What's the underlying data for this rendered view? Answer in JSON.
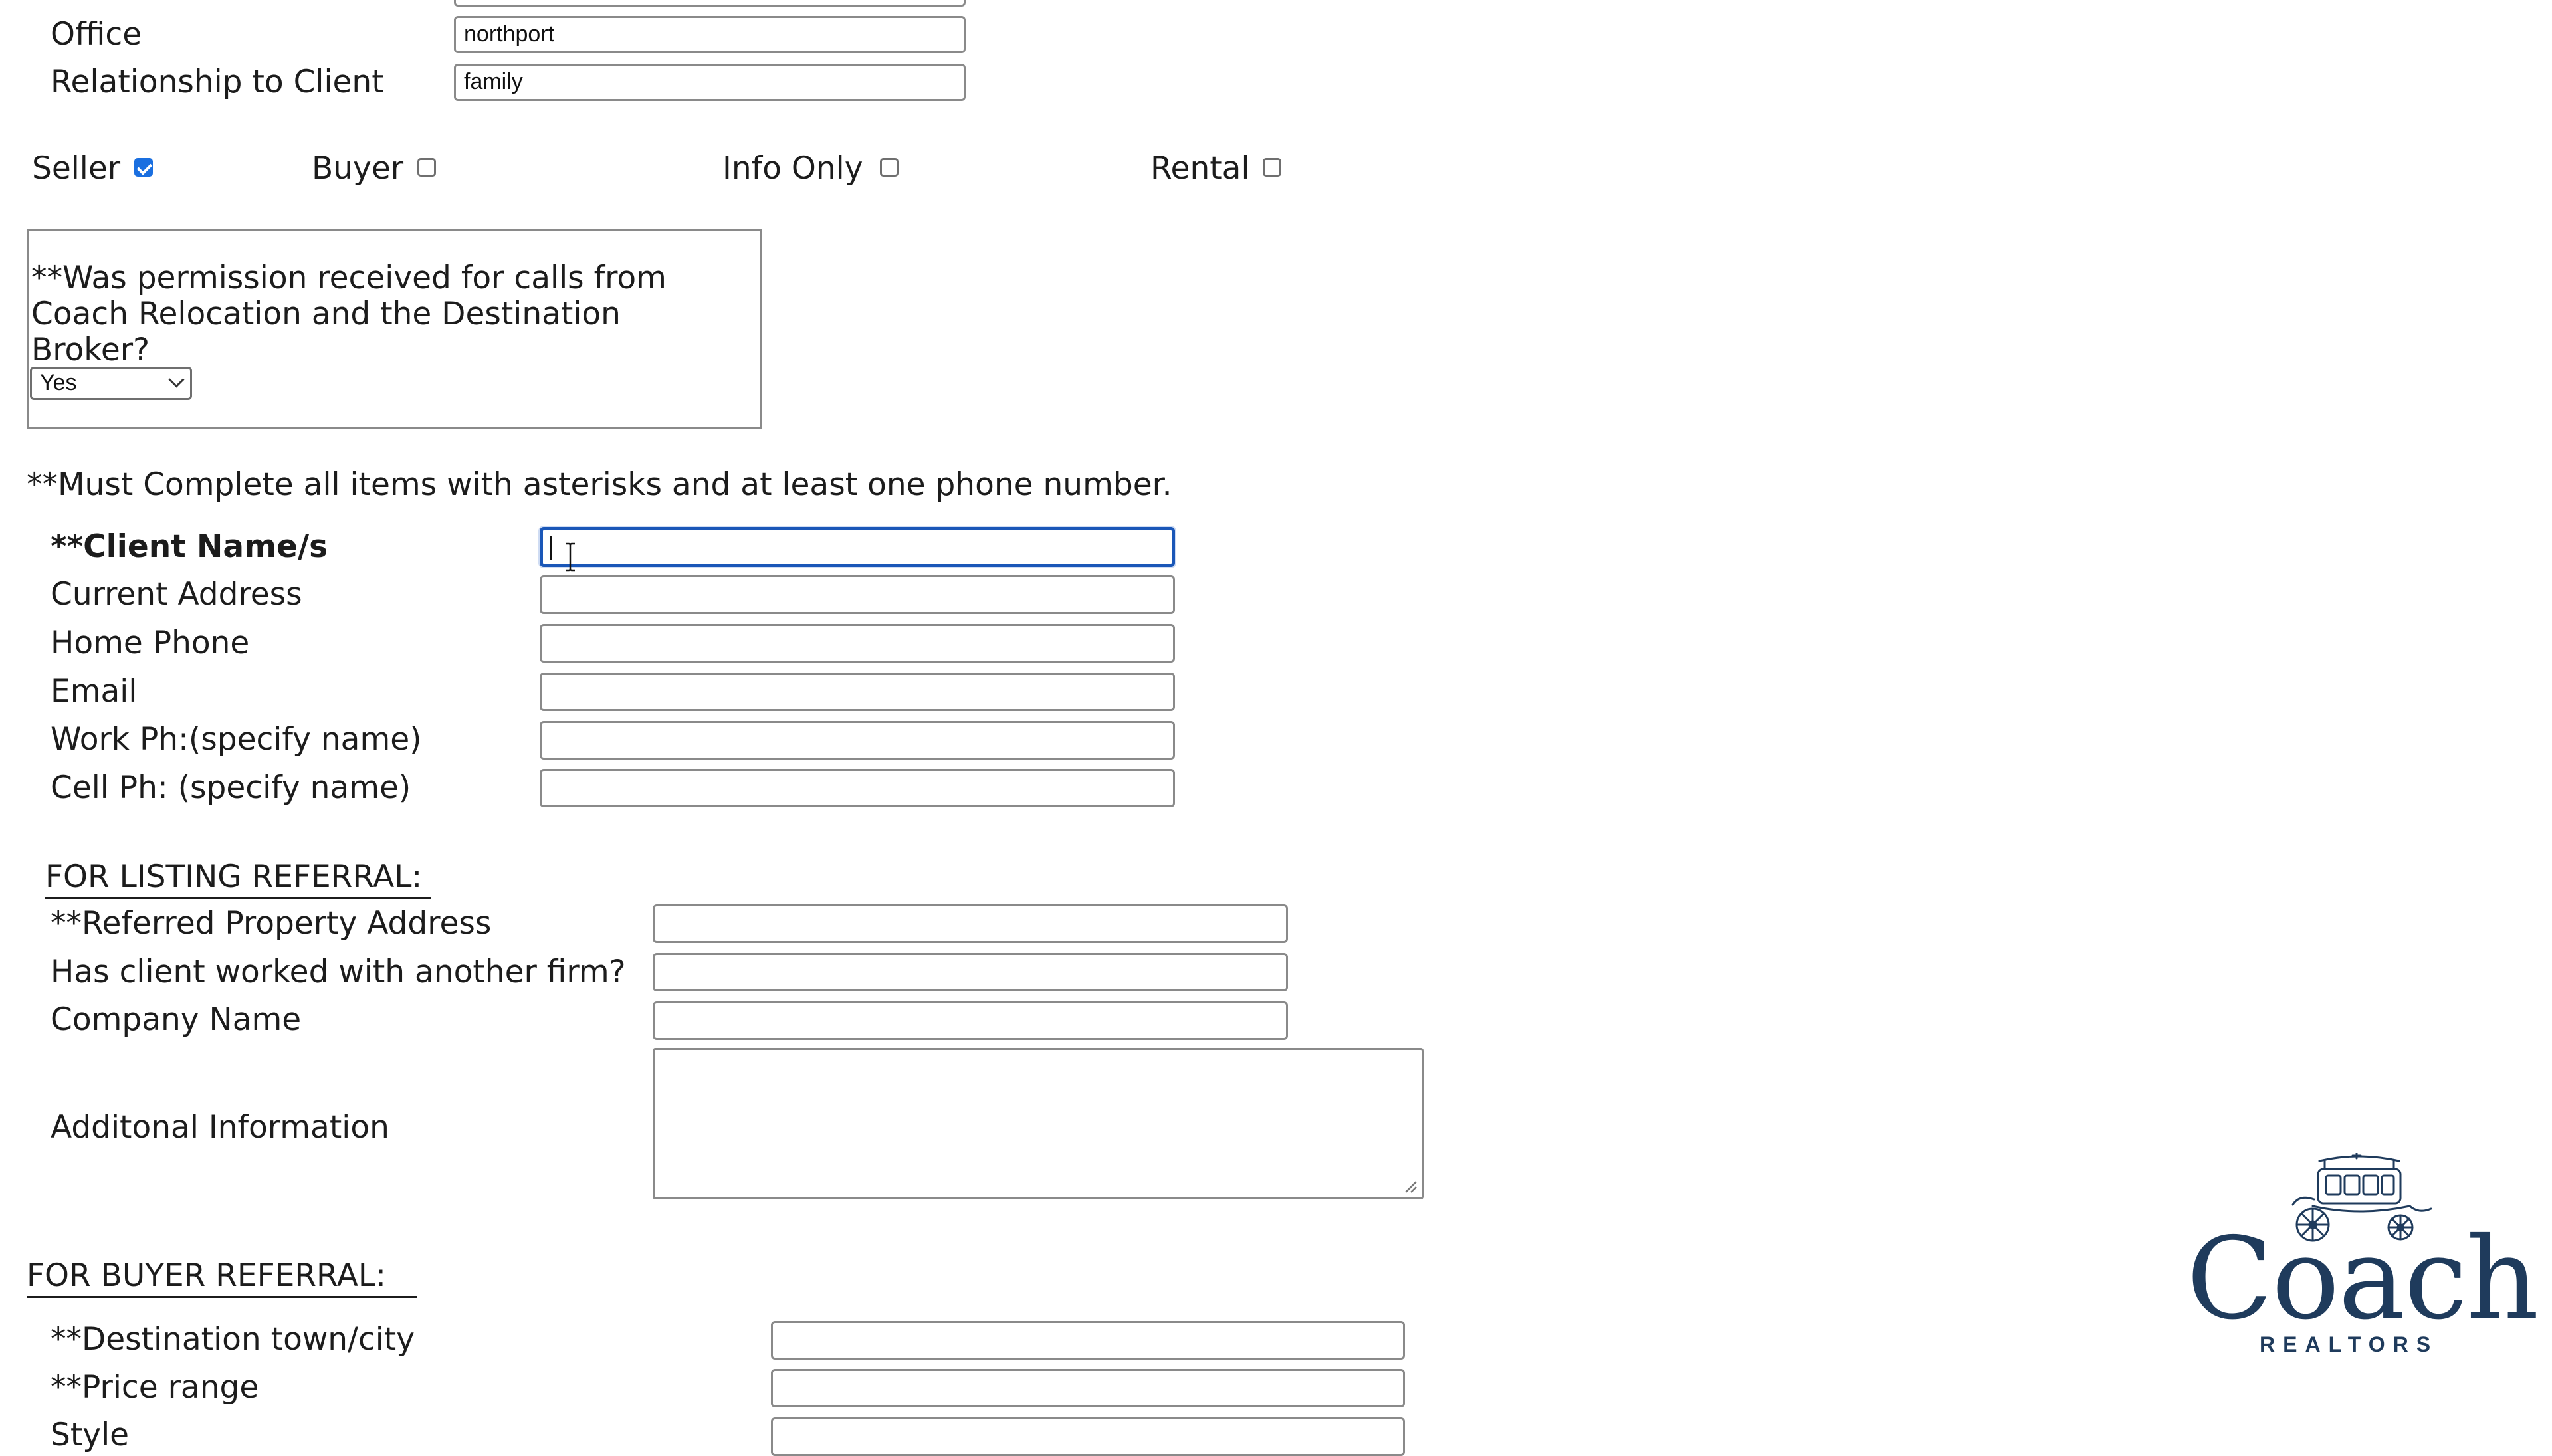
{
  "agent": {
    "office_label": "Office",
    "office_value": "northport",
    "relationship_label": "Relationship to Client",
    "relationship_value": "family"
  },
  "referral_types": [
    {
      "label": "Seller",
      "checked": true
    },
    {
      "label": "Buyer",
      "checked": false
    },
    {
      "label": "Info Only",
      "checked": false
    },
    {
      "label": "Rental",
      "checked": false
    }
  ],
  "permission": {
    "question": "**Was permission received for calls from Coach Relocation and the Destination Broker?",
    "selected": "Yes"
  },
  "instructions": "**Must Complete all items with asterisks and at least one phone number.",
  "client": {
    "name_label": "**Client Name/s",
    "address_label": "Current Address",
    "home_phone_label": "Home Phone",
    "email_label": "Email",
    "work_phone_label": "Work Ph:(specify name)",
    "cell_phone_label": "Cell Ph: (specify name)"
  },
  "listing_referral": {
    "heading": "FOR LISTING REFERRAL:",
    "property_address_label": "**Referred Property Address",
    "other_firm_label": "Has client worked with another firm?",
    "company_label": "Company Name",
    "additional_label": "Additonal Information"
  },
  "buyer_referral": {
    "heading": "FOR BUYER REFERRAL:",
    "destination_label": "**Destination town/city",
    "price_label": "**Price range",
    "style_label": "Style"
  },
  "logo": {
    "word": "Coach",
    "sub": "REALTORS",
    "icon": "carriage-icon",
    "color": "#1f3b5c"
  },
  "colors": {
    "focus": "#1a57b8",
    "checkbox_checked": "#1a6fe0"
  }
}
